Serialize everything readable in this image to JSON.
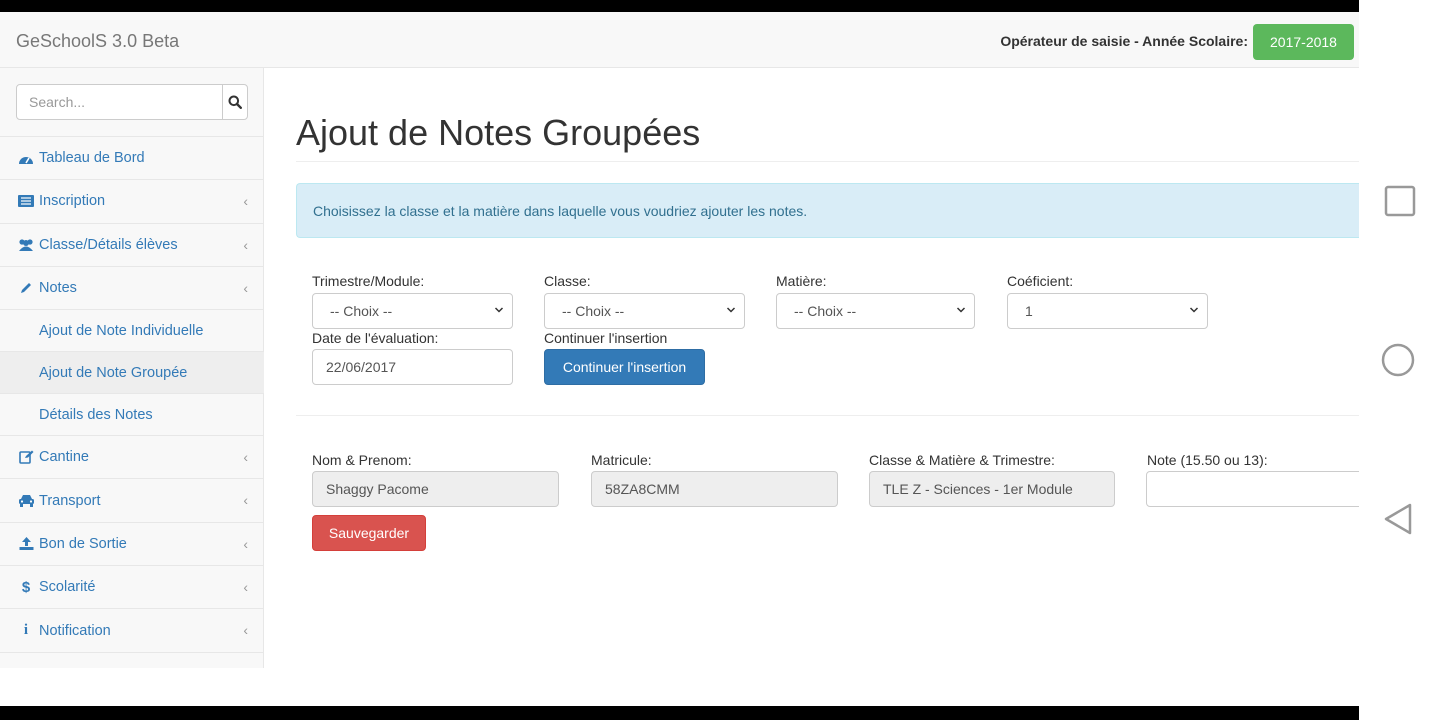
{
  "navbar": {
    "brand": "GeSchoolS 3.0 Beta",
    "operator_label": "Opérateur de saisie - Année Scolaire:",
    "school_year": "2017-2018",
    "school_year_color": "#5cb85c"
  },
  "sidebar": {
    "search_placeholder": "Search...",
    "items": [
      {
        "label": "Tableau de Bord",
        "icon": "dashboard-icon"
      },
      {
        "label": "Inscription",
        "icon": "list-icon"
      },
      {
        "label": "Classe/Détails élèves",
        "icon": "users-icon"
      },
      {
        "label": "Notes",
        "icon": "pencil-icon"
      },
      {
        "label": "Cantine",
        "icon": "edit-icon"
      },
      {
        "label": "Transport",
        "icon": "car-icon"
      },
      {
        "label": "Bon de Sortie",
        "icon": "upload-icon"
      },
      {
        "label": "Scolarité",
        "icon": "dollar-icon"
      },
      {
        "label": "Notification",
        "icon": "info-icon"
      }
    ],
    "notes_sub": [
      {
        "label": "Ajout de Note Individuelle"
      },
      {
        "label": "Ajout de Note Groupée"
      },
      {
        "label": "Détails des Notes"
      }
    ]
  },
  "main": {
    "title": "Ajout de Notes Groupées",
    "info": "Choisissez la classe et la matière dans laquelle vous voudriez ajouter les notes.",
    "form": {
      "trimestre_label": "Trimestre/Module:",
      "trimestre_value": "-- Choix --",
      "classe_label": "Classe:",
      "classe_value": "-- Choix --",
      "matiere_label": "Matière:",
      "matiere_value": "-- Choix --",
      "coef_label": "Coéficient:",
      "coef_value": "1",
      "date_label": "Date de l'évaluation:",
      "date_value": "22/06/2017",
      "continue_label": "Continuer l'insertion",
      "continue_button": "Continuer l'insertion"
    },
    "student": {
      "name_label": "Nom & Prenom:",
      "name_value": "Shaggy Pacome",
      "matricule_label": "Matricule:",
      "matricule_value": "58ZA8CMM",
      "classe_label": "Classe & Matière & Trimestre:",
      "classe_value": "TLE Z - Sciences - 1er Module",
      "note_label": "Note (15.50 ou 13):",
      "note_value": "",
      "save_button": "Sauvegarder"
    }
  },
  "colors": {
    "link": "#337ab7",
    "primary": "#337ab7",
    "danger": "#d9534f",
    "info_bg": "#d9edf7"
  }
}
